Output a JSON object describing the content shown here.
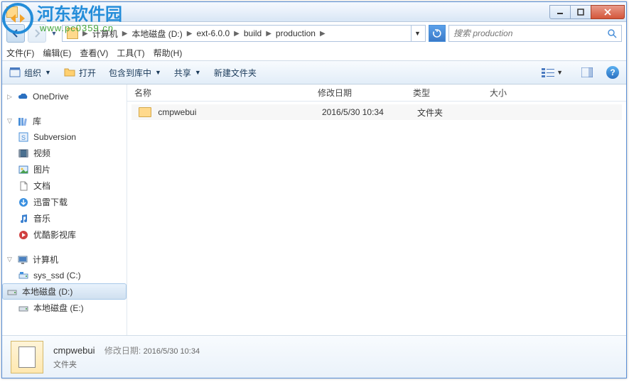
{
  "watermark": {
    "text": "河东软件园",
    "url": "www.pc0359.cn"
  },
  "window": {
    "title": ""
  },
  "breadcrumb": {
    "items": [
      "计算机",
      "本地磁盘 (D:)",
      "ext-6.0.0",
      "build",
      "production"
    ]
  },
  "search": {
    "placeholder": "搜索 production"
  },
  "menubar": {
    "items": [
      "文件(F)",
      "编辑(E)",
      "查看(V)",
      "工具(T)",
      "帮助(H)"
    ]
  },
  "toolbar": {
    "organize": "组织",
    "open": "打开",
    "include": "包含到库中",
    "share": "共享",
    "newfolder": "新建文件夹"
  },
  "columns": {
    "name": "名称",
    "date": "修改日期",
    "type": "类型",
    "size": "大小"
  },
  "sidebar": {
    "onedrive": "OneDrive",
    "library": "库",
    "items": [
      {
        "label": "Subversion",
        "icon": "svn"
      },
      {
        "label": "视频",
        "icon": "video"
      },
      {
        "label": "图片",
        "icon": "image"
      },
      {
        "label": "文档",
        "icon": "doc"
      },
      {
        "label": "迅雷下载",
        "icon": "download"
      },
      {
        "label": "音乐",
        "icon": "music"
      },
      {
        "label": "优酷影视库",
        "icon": "youku"
      }
    ],
    "computer": "计算机",
    "drives": [
      {
        "label": "sys_ssd (C:)"
      },
      {
        "label": "本地磁盘 (D:)",
        "selected": true
      },
      {
        "label": "本地磁盘 (E:)"
      }
    ]
  },
  "files": [
    {
      "name": "cmpwebui",
      "date": "2016/5/30 10:34",
      "type": "文件夹",
      "size": ""
    }
  ],
  "statusbar": {
    "name": "cmpwebui",
    "date_label": "修改日期:",
    "date": "2016/5/30 10:34",
    "type": "文件夹"
  }
}
